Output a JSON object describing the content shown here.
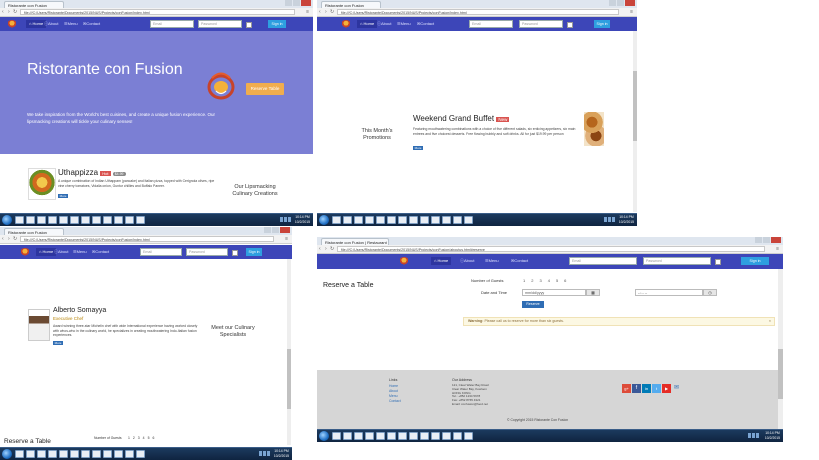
{
  "browser": {
    "tab_title_1": "Ristorante con Fusion",
    "tab_title_2": "Ristorante con Fusion",
    "tab_title_3": "Ristorante con Fusion",
    "tab_title_4": "Ristorante con Fusion | Restaurant",
    "url_1": "file:///C:/Users/Ristorante/Documents/2015/NUS/Projects/conFusion/index.html",
    "url_2": "file:///C:/Users/Ristorante/Documents/2015/NUS/Projects/conFusion/index.html",
    "url_3": "file:///C:/Users/Ristorante/Documents/2015/NUS/Projects/conFusion/index.html",
    "url_4": "file:///C:/Users/Ristorante/Documents/2015/NUS/Projects/conFusion/aboutus.html#reserve"
  },
  "nav": {
    "home": "Home",
    "about": "About",
    "menu": "Menu",
    "contact": "Contact",
    "email_placeholder": "Email",
    "password_placeholder": "Password",
    "sign_in": "Sign in"
  },
  "hero": {
    "title": "Ristorante con Fusion",
    "tagline": "We take inspiration from the World's best cuisines, and create a unique fusion experience. Our lipsmacking creations will tickle your culinary senses!",
    "reserve_button": "Reserve Table"
  },
  "dish": {
    "name": "Uthappizza",
    "badge": "Hot",
    "price": "$4.99",
    "description": "A unique combination of Indian Uthappam (pancake) and Italian pizza, topped with Cerignola olives, ripe vine cherry tomatoes, Vidalia onion, Guntur chillies and Buffalo Paneer.",
    "button": "More",
    "side_heading": "Our Lipsmacking Culinary Creations"
  },
  "promo": {
    "name": "Weekend Grand Buffet",
    "badge": "New",
    "description": "Featuring mouthwatering combinations with a choice of five different salads, six enticing appetizers, six main entrees and five choicest desserts. Free flowing bubbly and soft drinks. All for just $19.99 per person",
    "button": "More",
    "side_heading": "This Month's Promotions"
  },
  "chef": {
    "name": "Alberto Somayya",
    "role": "Executive Chef",
    "description": "Award winning three-star Michelin chef with wide International experience having worked closely with whos-who in the culinary world, he specializes in creating mouthwatering Indo-Italian fusion experiences.",
    "button": "More",
    "side_heading": "Meet our Culinary Specialists"
  },
  "reserve": {
    "heading": "Reserve a Table",
    "guests_label": "Number of Guests",
    "guest_options": [
      "1",
      "2",
      "3",
      "4",
      "5",
      "6"
    ],
    "date_label": "Date and Time",
    "date_value": "mm/dd/yyyy",
    "time_value": "--:-- --",
    "submit": "Reserve",
    "warning_strong": "Warning:",
    "warning_text": "Please call us to reserve for more than six guests."
  },
  "footer": {
    "links_heading": "Links",
    "links": [
      "Home",
      "About",
      "Menu",
      "Contact"
    ],
    "address_heading": "Our Address",
    "address": [
      "121, Clear Water Bay Road",
      "Clear Water Bay, Kowloon",
      "HONG KONG",
      "Tel.: +852 1234 5678",
      "Fax: +852 8765 4321",
      "Email: confusion@food.net"
    ],
    "copyright": "© Copyright 2015 Ristorante Con Fusion"
  },
  "taskbar": {
    "time_1": "10:14 PM",
    "date_1": "10/2/2015",
    "time_2": "10:14 PM",
    "date_2": "10/2/2015",
    "time_3": "10:14 PM",
    "date_3": "10/2/2015",
    "time_4": "10:14 PM",
    "date_4": "10/2/2015"
  },
  "colors": {
    "navbar": "#3d46b8",
    "hero": "#7b7fd4",
    "taskbar": "#14304f",
    "badge": "#d9534f",
    "reserve_button": "#f0ad4e",
    "warning_bg": "#fcf8e3",
    "footer": "#d6d6d6"
  },
  "icons": [
    "back-icon",
    "forward-icon",
    "reload-icon",
    "menu-icon",
    "home-icon",
    "info-icon",
    "list-icon",
    "envelope-icon",
    "windows-start-icon",
    "calendar-icon",
    "clock-icon",
    "google-plus-icon",
    "facebook-icon",
    "linkedin-icon",
    "twitter-icon",
    "youtube-icon",
    "mail-icon"
  ]
}
